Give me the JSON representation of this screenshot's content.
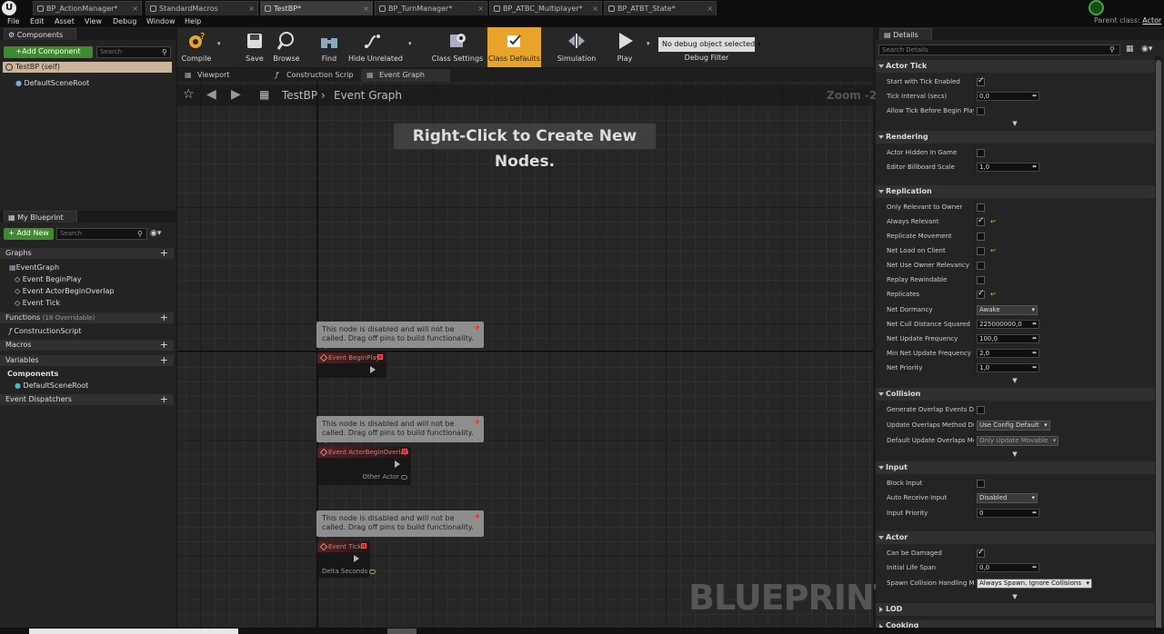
{
  "titlebar": {
    "tabs": [
      {
        "label": "BP_ActionManager*",
        "active": false
      },
      {
        "label": "StandardMacros",
        "active": false
      },
      {
        "label": "TestBP*",
        "active": true
      },
      {
        "label": "BP_TurnManager*",
        "active": false
      },
      {
        "label": "BP_ATBC_Multiplayer*",
        "active": false
      },
      {
        "label": "BP_ATBT_State*",
        "active": false
      }
    ],
    "parent_class_label": "Parent class:",
    "parent_class_value": "Actor"
  },
  "menubar": [
    "File",
    "Edit",
    "Asset",
    "View",
    "Debug",
    "Window",
    "Help"
  ],
  "components_panel": {
    "tab": "Components",
    "add_button": "+Add Component",
    "search_placeholder": "Search",
    "root_label": "TestBP (self)",
    "child": "DefaultSceneRoot"
  },
  "my_blueprint": {
    "tab": "My Blueprint",
    "add_new": "+ Add New",
    "search_placeholder": "Search",
    "graphs_label": "Graphs",
    "event_graph": "EventGraph",
    "events": [
      "Event BeginPlay",
      "Event ActorBeginOverlap",
      "Event Tick"
    ],
    "functions_label": "Functions",
    "functions_overridable": "(18 Overridable)",
    "function_item": "ConstructionScript",
    "macros_label": "Macros",
    "variables_label": "Variables",
    "components_label": "Components",
    "component_item": "DefaultSceneRoot",
    "dispatchers_label": "Event Dispatchers"
  },
  "toolbar": {
    "compile": "Compile",
    "save": "Save",
    "browse": "Browse",
    "find": "Find",
    "hide_unrelated": "Hide Unrelated",
    "class_settings": "Class Settings",
    "class_defaults": "Class Defaults",
    "simulation": "Simulation",
    "play": "Play",
    "debug_select": "No debug object selected",
    "debug_filter": "Debug Filter"
  },
  "editor_tabs": [
    "Viewport",
    "Construction Scrip",
    "Event Graph"
  ],
  "graph": {
    "breadcrumb_root": "TestBP",
    "breadcrumb_leaf": "Event Graph",
    "zoom": "Zoom -2",
    "hint": "Right-Click to Create New Nodes.",
    "watermark": "BLUEPRINT",
    "disabled_note": "This node is disabled and will not be called. Drag off pins to build functionality.",
    "nodes": [
      {
        "title": "Event BeginPlay",
        "pin": ""
      },
      {
        "title": "Event ActorBeginOverlap",
        "pin": "Other Actor"
      },
      {
        "title": "Event Tick",
        "pin": "Delta Seconds"
      }
    ]
  },
  "details": {
    "tab": "Details",
    "search_placeholder": "Search Details",
    "sections": {
      "actor_tick": "Actor Tick",
      "rendering": "Rendering",
      "replication": "Replication",
      "collision": "Collision",
      "input": "Input",
      "actor": "Actor",
      "lod": "LOD",
      "cooking": "Cooking"
    },
    "props": {
      "start_tick": "Start with Tick Enabled",
      "tick_interval": "Tick Interval (secs)",
      "tick_interval_val": "0,0",
      "allow_tick": "Allow Tick Before Begin Play",
      "hidden": "Actor Hidden In Game",
      "billboard": "Editor Billboard Scale",
      "billboard_val": "1,0",
      "only_relevant": "Only Relevant to Owner",
      "always_relevant": "Always Relevant",
      "replicate_movement": "Replicate Movement",
      "net_load": "Net Load on Client",
      "net_owner_rel": "Net Use Owner Relevancy",
      "replay_rewind": "Replay Rewindable",
      "replicates": "Replicates",
      "net_dormancy": "Net Dormancy",
      "net_dormancy_val": "Awake",
      "net_cull": "Net Cull Distance Squared",
      "net_cull_val": "225000000,0",
      "net_update": "Net Update Frequency",
      "net_update_val": "100,0",
      "min_net_update": "Min Net Update Frequency",
      "min_net_update_val": "2,0",
      "net_priority": "Net Priority",
      "net_priority_val": "1,0",
      "gen_overlap": "Generate Overlap Events Dur",
      "update_overlap": "Update Overlaps Method Dur",
      "update_overlap_val": "Use Config Default",
      "default_update": "Default Update Overlaps Met",
      "default_update_val": "Only Update Movable",
      "block_input": "Block Input",
      "auto_receive": "Auto Receive Input",
      "auto_receive_val": "Disabled",
      "input_priority": "Input Priority",
      "input_priority_val": "0",
      "can_damage": "Can be Damaged",
      "life_span": "Initial Life Span",
      "life_span_val": "0,0",
      "spawn_collision": "Spawn Collision Handling Me",
      "spawn_collision_val": "Always Spawn, Ignore Collisions"
    }
  },
  "colors": {
    "accent": "#e8a32c",
    "green": "#3e8a2e",
    "node_red": "#6a1c1c"
  }
}
